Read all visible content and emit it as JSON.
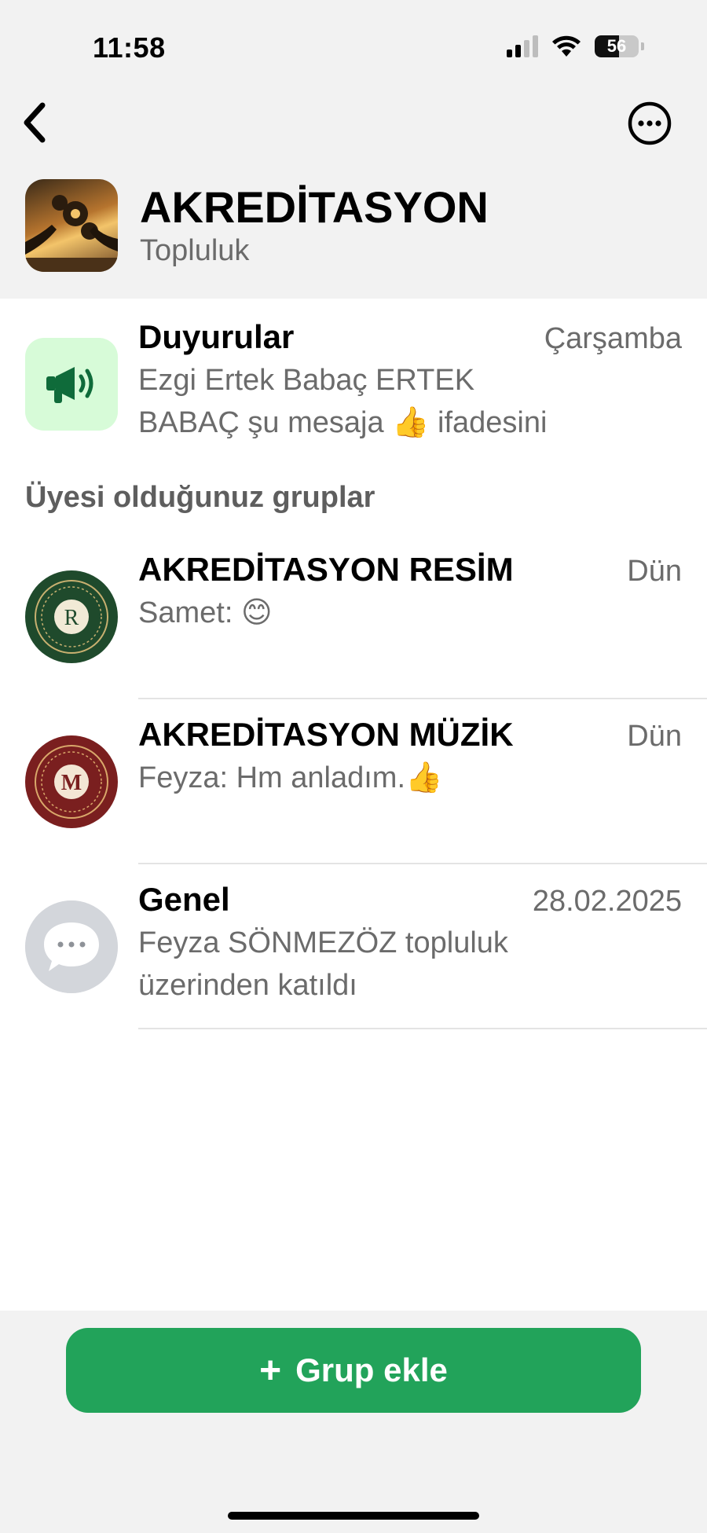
{
  "status_bar": {
    "time": "11:58",
    "battery": "56",
    "battery_level": 0.56
  },
  "community": {
    "title": "AKREDİTASYON",
    "subtitle": "Topluluk"
  },
  "announcements": {
    "title": "Duyurular",
    "time": "Çarşamba",
    "preview_line1": "Ezgi Ertek Babaç ERTEK",
    "preview_line2": "BABAÇ şu mesaja 👍 ifadesini"
  },
  "groups_section": {
    "title": "Üyesi olduğunuz gruplar"
  },
  "groups": [
    {
      "title": "AKREDİTASYON RESİM",
      "time": "Dün",
      "preview_line1": "Samet: 😊",
      "preview_line2": "",
      "avatar_letter": "R",
      "avatar_color": "#1f4a2c"
    },
    {
      "title": "AKREDİTASYON MÜZİK",
      "time": "Dün",
      "preview_line1": "Feyza: Hm anladım.👍",
      "preview_line2": "",
      "avatar_letter": "M",
      "avatar_color": "#7a1f1f"
    },
    {
      "title": "Genel",
      "time": "28.02.2025",
      "preview_line1": "Feyza SÖNMEZÖZ topluluk",
      "preview_line2": "üzerinden katıldı"
    }
  ],
  "add_button": {
    "plus": "+",
    "label": "Grup ekle"
  },
  "colors": {
    "accent": "#22a35a",
    "secondary_text": "#6b6b6b",
    "background_grey": "#f2f2f2"
  }
}
